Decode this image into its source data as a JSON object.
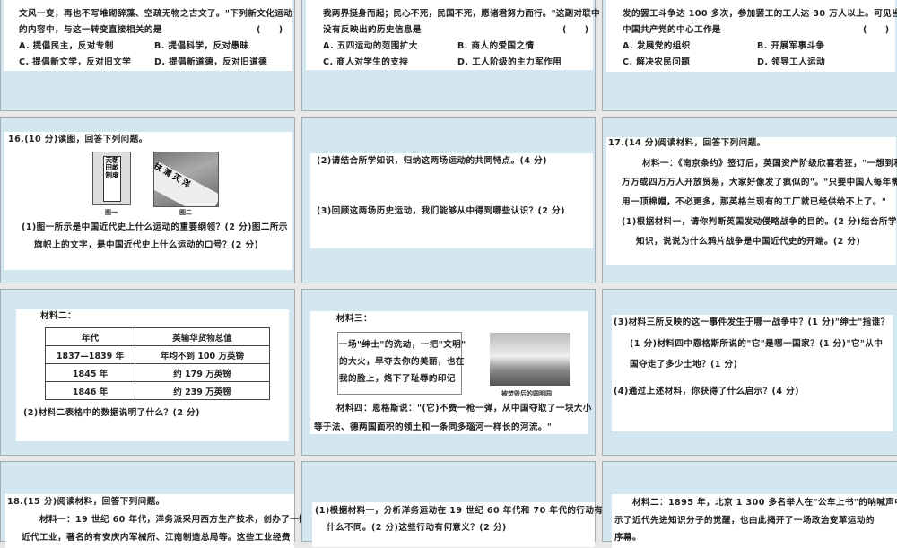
{
  "slides": {
    "s1": {
      "lines": [
        "文风一变，再也不写堆砌辞藻、空疏无物之古文了。\"下列新文化运动",
        "的内容中，与这一转变直接相关的是"
      ],
      "bracket": "(　　)",
      "options": [
        "A. 提倡民主，反对专制",
        "B. 提倡科学，反对愚昧",
        "C. 提倡新文学，反对旧文学",
        "D. 提倡新道德，反对旧道德"
      ]
    },
    "s2": {
      "lines": [
        "我两界挺身而起；民心不死，民国不死，愿诸君努力而行。\"这副对联中",
        "没有反映出的历史信息是"
      ],
      "bracket": "(　　)",
      "options": [
        "A. 五四运动的范围扩大",
        "B. 商人的爱国之情",
        "C. 商人对学生的支持",
        "D. 工人阶级的主力军作用"
      ]
    },
    "s3": {
      "lines": [
        "发的罢工斗争达 100 多次，参加罢工的工人达 30 万人以上。可见当时",
        "中国共产党的中心工作是"
      ],
      "bracket": "(　　)",
      "options": [
        "A. 发展党的组织",
        "B. 开展军事斗争",
        "C. 解决农民问题",
        "D. 领导工人运动"
      ]
    },
    "s4": {
      "title": "16.(10 分)读图，回答下列问题。",
      "img1_text": "天朝田畝制度",
      "img2_text": "扶清灭洋",
      "cap1": "图一",
      "cap2": "图二",
      "q1": "(1)图一所示是中国近代史上什么运动的重要纲领？(2 分)图二所示",
      "q2": "旗帜上的文字，是中国近代史上什么运动的口号？(2 分)"
    },
    "s5": {
      "q2": "(2)请结合所学知识，归纳这两场运动的共同特点。(4 分)",
      "q3": "(3)回顾这两场历史运动，我们能够从中得到哪些认识？(2 分)"
    },
    "s6": {
      "lines": [
        "17.(14 分)阅读材料，回答下列问题。",
        "材料一：《南京条约》签订后，英国资产阶级欣喜若狂，\"一想到和三",
        "万万或四万万人开放贸易，大家好像发了疯似的\"。\"只要中国人每年需",
        "用一顶棉帽，不必更多，那英格兰现有的工厂就已经供给不上了。\"",
        "(1)根据材料一，请你判断英国发动侵略战争的目的。(2 分)结合所学",
        "知识，说说为什么鸦片战争是中国近代史的开端。(2 分)"
      ]
    },
    "s7": {
      "label": "材料二：",
      "headers": [
        "年代",
        "英输华货物总值"
      ],
      "rows": [
        [
          "1837—1839 年",
          "年均不到 100 万英镑"
        ],
        [
          "1845 年",
          "约 179 万英镑"
        ],
        [
          "1846 年",
          "约 239 万英镑"
        ]
      ],
      "q": "(2)材料二表格中的数据说明了什么？(2 分)"
    },
    "s8": {
      "label": "材料三：",
      "poem": [
        "一场\"绅士\"的洗劫，一把\"文明\"",
        "的大火，早夺去你的美丽，也在",
        "我的脸上，烙下了耻辱的印记"
      ],
      "caption": "被焚毁后的圆明园",
      "m4": [
        "材料四：恩格斯说：\"(它)不费一枪一弹，从中国夺取了一块大小",
        "等于法、德两国面积的领土和一条同多瑙河一样长的河流。\""
      ]
    },
    "s9": {
      "lines": [
        "(3)材料三所反映的这一事件发生于哪一战争中？(1 分)\"绅士\"指谁？",
        "(1 分)材料四中恩格斯所说的\"它\"是哪一国家？(1 分)\"它\"从中",
        "国夺走了多少土地？(1 分)",
        "(4)通过上述材料，你获得了什么启示？(4 分)"
      ]
    },
    "s10": {
      "lines": [
        "18.(15 分)阅读材料，回答下列问题。",
        "材料一：19 世纪 60 年代，洋务派采用西方生产技术，创办了一批",
        "近代工业，著名的有安庆内军械所、江南制造总局等。这些工业经费"
      ]
    },
    "s11": {
      "lines": [
        "(1)根据材料一，分析洋务运动在 19 世纪 60 年代和 70 年代的行动有",
        "什么不同。(2 分)这些行动有何意义？(2 分)"
      ]
    },
    "s12": {
      "lines": [
        "材料二：1895 年，北京 1 300 多名举人在\"公车上书\"的呐喊声中展",
        "示了近代先进知识分子的觉醒，也由此揭开了一场政治变革运动的",
        "序幕。"
      ]
    }
  }
}
